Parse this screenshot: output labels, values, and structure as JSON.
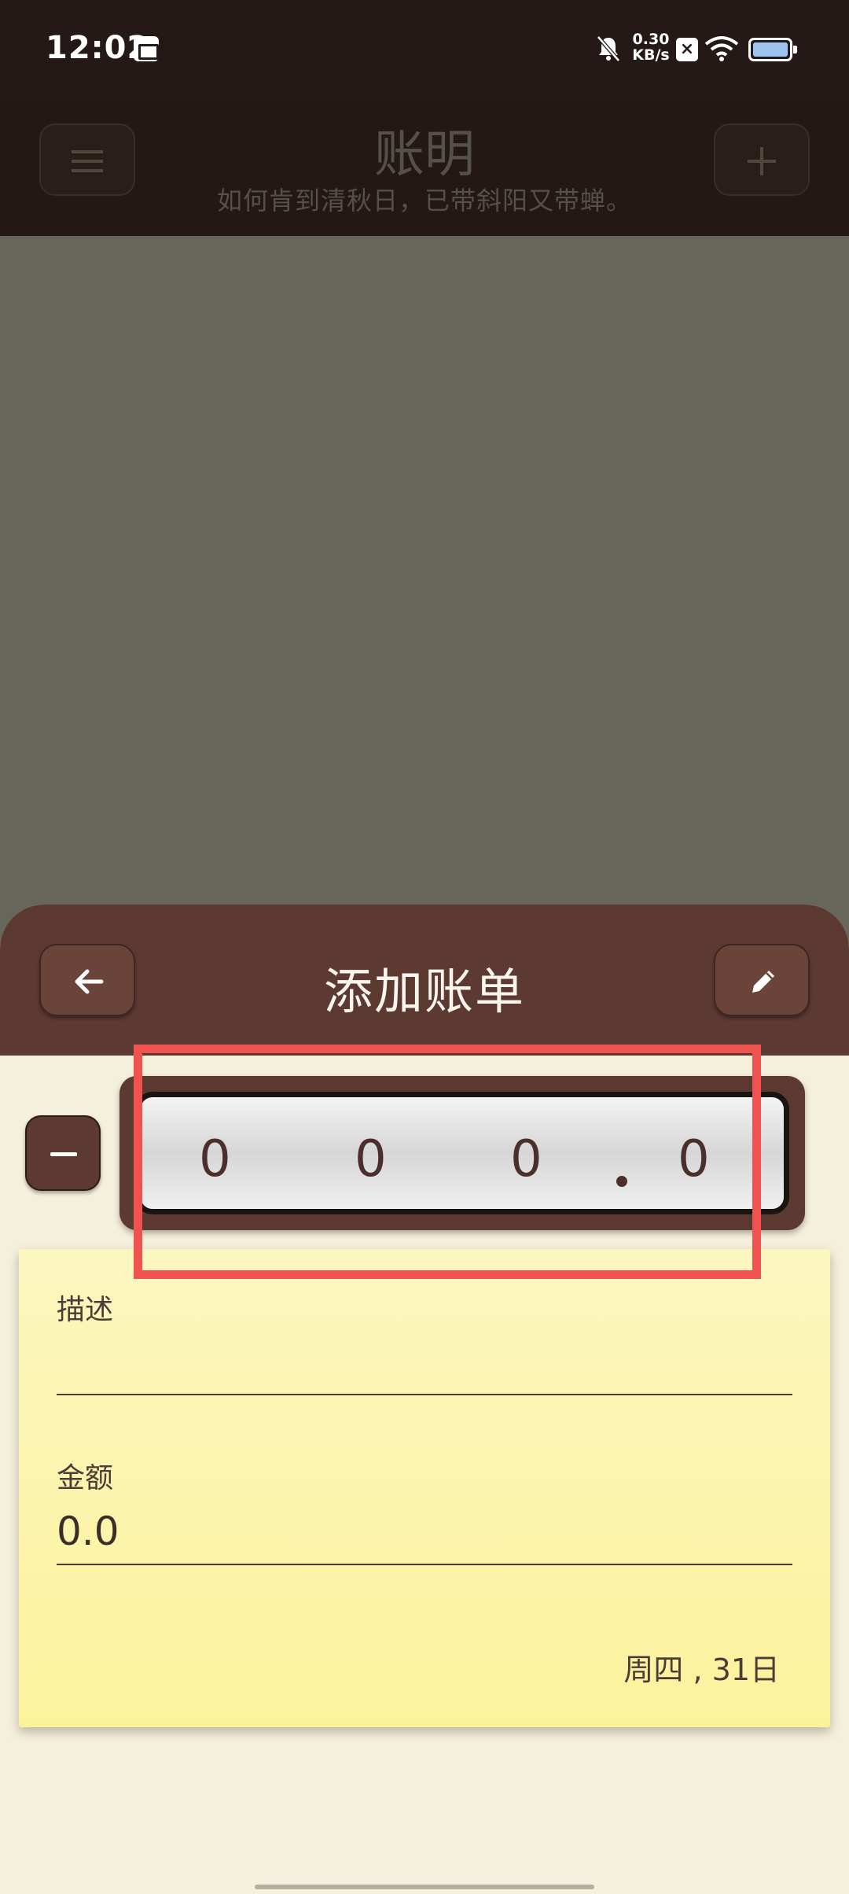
{
  "status_bar": {
    "time": "12:02",
    "net_speed_value": "0.30",
    "net_speed_unit": "KB/s"
  },
  "app": {
    "title": "账明",
    "subtitle": "如何肯到清秋日，已带斜阳又带蝉。",
    "menu_icon": "menu-icon",
    "add_icon": "plus-icon"
  },
  "sheet": {
    "title": "添加账单",
    "back_icon": "arrow-left-icon",
    "edit_icon": "pencil-icon",
    "minus_icon": "minus-icon"
  },
  "odometer": {
    "digits": [
      "0",
      "0",
      "0",
      "0"
    ]
  },
  "form": {
    "description_label": "描述",
    "description_value": "",
    "amount_label": "金额",
    "amount_value": "0.0",
    "date": "周四 , 31日"
  },
  "colors": {
    "header_brown": "#5c3a32",
    "status_bar": "#241917",
    "note_yellow": "#fdf29c",
    "highlight_red": "#ef524f",
    "background": "#f5f0dc"
  }
}
